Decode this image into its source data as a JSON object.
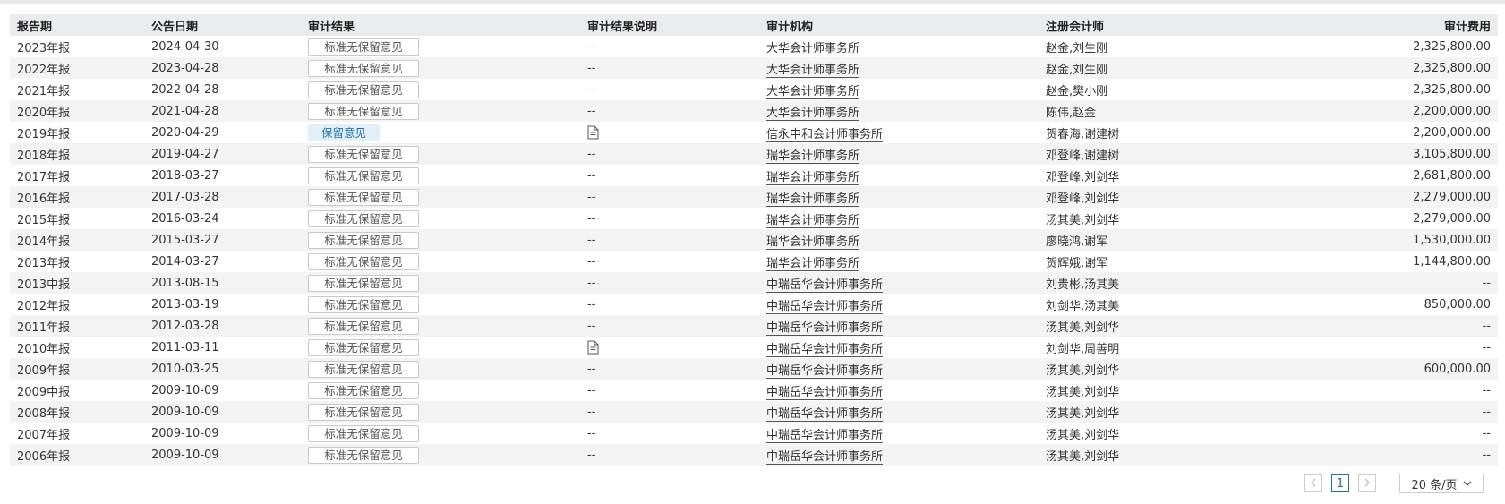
{
  "table": {
    "headers": {
      "period": "报告期",
      "date": "公告日期",
      "result": "审计结果",
      "explain": "审计结果说明",
      "firm": "审计机构",
      "cpa": "注册会计师",
      "fee": "审计费用"
    },
    "rows": [
      {
        "period": "2023年报",
        "date": "2024-04-30",
        "result": "标准无保留意见",
        "result_type": "standard",
        "explain": "--",
        "explain_icon": false,
        "firm": "大华会计师事务所",
        "cpa": "赵金,刘生刚",
        "fee": "2,325,800.00"
      },
      {
        "period": "2022年报",
        "date": "2023-04-28",
        "result": "标准无保留意见",
        "result_type": "standard",
        "explain": "--",
        "explain_icon": false,
        "firm": "大华会计师事务所",
        "cpa": "赵金,刘生刚",
        "fee": "2,325,800.00"
      },
      {
        "period": "2021年报",
        "date": "2022-04-28",
        "result": "标准无保留意见",
        "result_type": "standard",
        "explain": "--",
        "explain_icon": false,
        "firm": "大华会计师事务所",
        "cpa": "赵金,樊小刚",
        "fee": "2,325,800.00"
      },
      {
        "period": "2020年报",
        "date": "2021-04-28",
        "result": "标准无保留意见",
        "result_type": "standard",
        "explain": "--",
        "explain_icon": false,
        "firm": "大华会计师事务所",
        "cpa": "陈伟,赵金",
        "fee": "2,200,000.00"
      },
      {
        "period": "2019年报",
        "date": "2020-04-29",
        "result": "保留意见",
        "result_type": "qualified",
        "explain": "",
        "explain_icon": true,
        "firm": "信永中和会计师事务所",
        "cpa": "贺春海,谢建树",
        "fee": "2,200,000.00"
      },
      {
        "period": "2018年报",
        "date": "2019-04-27",
        "result": "标准无保留意见",
        "result_type": "standard",
        "explain": "--",
        "explain_icon": false,
        "firm": "瑞华会计师事务所",
        "cpa": "邓登峰,谢建树",
        "fee": "3,105,800.00"
      },
      {
        "period": "2017年报",
        "date": "2018-03-27",
        "result": "标准无保留意见",
        "result_type": "standard",
        "explain": "--",
        "explain_icon": false,
        "firm": "瑞华会计师事务所",
        "cpa": "邓登峰,刘剑华",
        "fee": "2,681,800.00"
      },
      {
        "period": "2016年报",
        "date": "2017-03-28",
        "result": "标准无保留意见",
        "result_type": "standard",
        "explain": "--",
        "explain_icon": false,
        "firm": "瑞华会计师事务所",
        "cpa": "邓登峰,刘剑华",
        "fee": "2,279,000.00"
      },
      {
        "period": "2015年报",
        "date": "2016-03-24",
        "result": "标准无保留意见",
        "result_type": "standard",
        "explain": "--",
        "explain_icon": false,
        "firm": "瑞华会计师事务所",
        "cpa": "汤其美,刘剑华",
        "fee": "2,279,000.00"
      },
      {
        "period": "2014年报",
        "date": "2015-03-27",
        "result": "标准无保留意见",
        "result_type": "standard",
        "explain": "--",
        "explain_icon": false,
        "firm": "瑞华会计师事务所",
        "cpa": "廖晓鸿,谢军",
        "fee": "1,530,000.00"
      },
      {
        "period": "2013年报",
        "date": "2014-03-27",
        "result": "标准无保留意见",
        "result_type": "standard",
        "explain": "--",
        "explain_icon": false,
        "firm": "瑞华会计师事务所",
        "cpa": "贺辉娥,谢军",
        "fee": "1,144,800.00"
      },
      {
        "period": "2013中报",
        "date": "2013-08-15",
        "result": "标准无保留意见",
        "result_type": "standard",
        "explain": "--",
        "explain_icon": false,
        "firm": "中瑞岳华会计师事务所",
        "cpa": "刘贵彬,汤其美",
        "fee": "--"
      },
      {
        "period": "2012年报",
        "date": "2013-03-19",
        "result": "标准无保留意见",
        "result_type": "standard",
        "explain": "--",
        "explain_icon": false,
        "firm": "中瑞岳华会计师事务所",
        "cpa": "刘剑华,汤其美",
        "fee": "850,000.00"
      },
      {
        "period": "2011年报",
        "date": "2012-03-28",
        "result": "标准无保留意见",
        "result_type": "standard",
        "explain": "--",
        "explain_icon": false,
        "firm": "中瑞岳华会计师事务所",
        "cpa": "汤其美,刘剑华",
        "fee": "--"
      },
      {
        "period": "2010年报",
        "date": "2011-03-11",
        "result": "标准无保留意见",
        "result_type": "standard",
        "explain": "",
        "explain_icon": true,
        "firm": "中瑞岳华会计师事务所",
        "cpa": "刘剑华,周善明",
        "fee": "--"
      },
      {
        "period": "2009年报",
        "date": "2010-03-25",
        "result": "标准无保留意见",
        "result_type": "standard",
        "explain": "--",
        "explain_icon": false,
        "firm": "中瑞岳华会计师事务所",
        "cpa": "汤其美,刘剑华",
        "fee": "600,000.00"
      },
      {
        "period": "2009中报",
        "date": "2009-10-09",
        "result": "标准无保留意见",
        "result_type": "standard",
        "explain": "--",
        "explain_icon": false,
        "firm": "中瑞岳华会计师事务所",
        "cpa": "汤其美,刘剑华",
        "fee": "--"
      },
      {
        "period": "2008年报",
        "date": "2009-10-09",
        "result": "标准无保留意见",
        "result_type": "standard",
        "explain": "--",
        "explain_icon": false,
        "firm": "中瑞岳华会计师事务所",
        "cpa": "汤其美,刘剑华",
        "fee": "--"
      },
      {
        "period": "2007年报",
        "date": "2009-10-09",
        "result": "标准无保留意见",
        "result_type": "standard",
        "explain": "--",
        "explain_icon": false,
        "firm": "中瑞岳华会计师事务所",
        "cpa": "汤其美,刘剑华",
        "fee": "--"
      },
      {
        "period": "2006年报",
        "date": "2009-10-09",
        "result": "标准无保留意见",
        "result_type": "standard",
        "explain": "--",
        "explain_icon": false,
        "firm": "中瑞岳华会计师事务所",
        "cpa": "汤其美,刘剑华",
        "fee": "--"
      }
    ]
  },
  "pagination": {
    "prev_icon": "chevron-left-icon",
    "next_icon": "chevron-right-icon",
    "current_page": "1",
    "page_size": "20 条/页"
  },
  "colors": {
    "header_bg": "#e9ebed",
    "stripe_bg": "#f3f3f3",
    "qualified_text": "#1f6fa8",
    "qualified_bg": "#e3eff7"
  }
}
